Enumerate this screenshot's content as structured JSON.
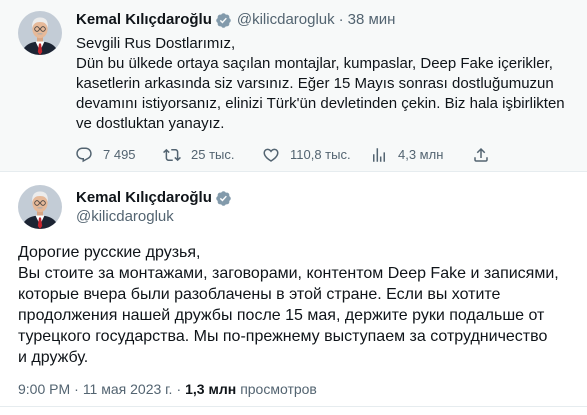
{
  "colors": {
    "text_primary": "#0f1419",
    "text_secondary": "#536471",
    "verified_badge": "#829aab",
    "divider": "#e6ecef",
    "timeline_background": "#f7f9f9"
  },
  "top_tweet": {
    "avatar_icon": "profile-photo",
    "author_name": "Kemal Kılıçdaroğlu",
    "verified_icon": "verified-badge-icon",
    "handle": "@kilicdarogluk",
    "separator": "·",
    "time": "38 мин",
    "text": "Sevgili Rus Dostlarımız,\nDün bu ülkede ortaya saçılan montajlar, kumpaslar, Deep Fake içerikler,\nkasetlerin arkasında siz varsınız. Eğer 15 Mayıs sonrası dostluğumuzun\ndevamını istiyorsanız, elinizi Türk'ün devletinden çekin. Biz hala işbirlikten\nve dostluktan yanayız.",
    "actions": {
      "reply": {
        "icon": "reply-icon",
        "count": "7 495"
      },
      "retweet": {
        "icon": "retweet-icon",
        "count": "25 тыс."
      },
      "like": {
        "icon": "heart-icon",
        "count": "110,8 тыс."
      },
      "views": {
        "icon": "views-icon",
        "count": "4,3 млн"
      },
      "share": {
        "icon": "share-icon"
      }
    }
  },
  "main_tweet": {
    "avatar_icon": "profile-photo",
    "author_name": "Kemal Kılıçdaroğlu",
    "verified_icon": "verified-badge-icon",
    "handle": "@kilicdarogluk",
    "text": "Дорогие русские друзья,\nВы стоите за монтажами, заговорами, контентом Deep Fake и записями,\nкоторые вчера были разоблачены в этой стране. Если вы хотите\nпродолжения нашей дружбы после 15 мая, держите руки подальше от\nтурецкого государства. Мы по-прежнему выступаем за сотрудничество\nи дружбу.",
    "footer": {
      "time": "9:00 PM",
      "separator": "·",
      "date": "11 мая 2023 г.",
      "views_count": "1,3 млн",
      "views_label": "просмотров"
    }
  }
}
